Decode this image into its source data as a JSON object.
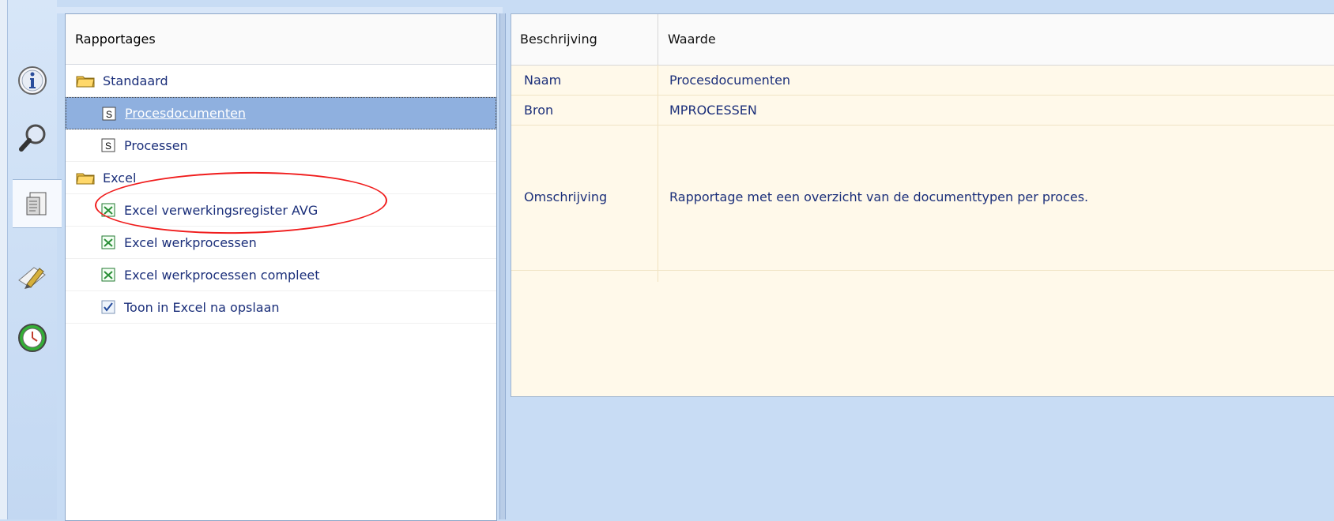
{
  "sidebar": {
    "buttons": [
      {
        "name": "info-icon",
        "active": false
      },
      {
        "name": "magnifier-icon",
        "active": false
      },
      {
        "name": "report-icon",
        "active": true
      },
      {
        "name": "edit-pencil-icon",
        "active": false
      },
      {
        "name": "clock-sync-icon",
        "active": false
      }
    ]
  },
  "tree": {
    "header": "Rapportages",
    "rows": [
      {
        "label": "Standaard",
        "icon": "folder-icon",
        "level": 0
      },
      {
        "label": "Procesdocumenten",
        "icon": "s-report-icon",
        "level": 1,
        "selected": true
      },
      {
        "label": "Processen",
        "icon": "s-report-icon",
        "level": 1
      },
      {
        "label": "Excel",
        "icon": "folder-icon",
        "level": 0
      },
      {
        "label": "Excel verwerkingsregister AVG",
        "icon": "excel-icon",
        "level": 1,
        "circled": true
      },
      {
        "label": "Excel werkprocessen",
        "icon": "excel-icon",
        "level": 1
      },
      {
        "label": "Excel werkprocessen compleet",
        "icon": "excel-icon",
        "level": 1
      },
      {
        "label": "Toon in Excel na opslaan",
        "icon": "checkbox-icon",
        "level": 1,
        "checked": true
      }
    ]
  },
  "properties": {
    "headers": {
      "col1": "Beschrijving",
      "col2": "Waarde"
    },
    "rows": [
      {
        "name": "Naam",
        "value": "Procesdocumenten"
      },
      {
        "name": "Bron",
        "value": "MPROCESSEN"
      },
      {
        "name": "Omschrijving",
        "value": "Rapportage met een overzicht van de documenttypen per proces."
      }
    ]
  },
  "colors": {
    "selection": "#8fb0df",
    "annotation": "#f01c1c",
    "text": "#1b2f7a"
  }
}
